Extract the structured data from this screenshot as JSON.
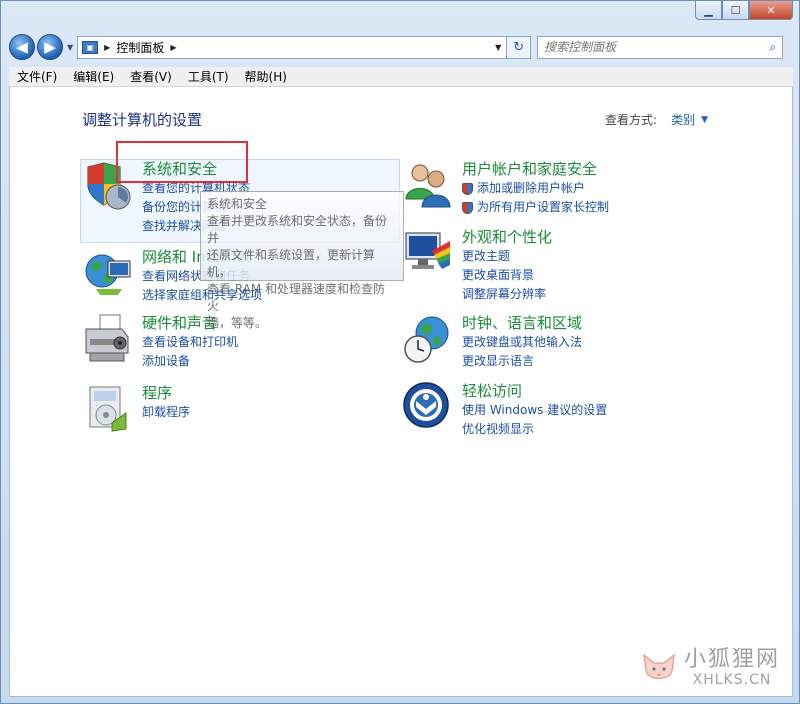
{
  "window": {
    "minimize_glyph": "▁",
    "maximize_glyph": "☐",
    "close_glyph": "✕"
  },
  "nav": {
    "back_glyph": "◀",
    "forward_glyph": "▶",
    "address_path": "控制面板",
    "refresh_glyph": "↻",
    "search_placeholder": "搜索控制面板",
    "search_glyph": "⌕"
  },
  "menu": [
    "文件(F)",
    "编辑(E)",
    "查看(V)",
    "工具(T)",
    "帮助(H)"
  ],
  "main": {
    "title": "调整计算机的设置",
    "view_by_label": "查看方式:",
    "view_by_value": "类别"
  },
  "categories": {
    "system_security": {
      "title": "系统和安全",
      "links": [
        "查看您的计算机状态",
        "备份您的计算机",
        "查找并解决问题"
      ]
    },
    "network": {
      "title": "网络和 Internet",
      "links": [
        "查看网络状态和任务",
        "选择家庭组和共享选项"
      ]
    },
    "hardware": {
      "title": "硬件和声音",
      "links": [
        "查看设备和打印机",
        "添加设备"
      ]
    },
    "programs": {
      "title": "程序",
      "links": [
        "卸载程序"
      ]
    },
    "user_accounts": {
      "title": "用户帐户和家庭安全",
      "links": [
        "添加或删除用户帐户",
        "为所有用户设置家长控制"
      ]
    },
    "appearance": {
      "title": "外观和个性化",
      "links": [
        "更改主题",
        "更改桌面背景",
        "调整屏幕分辨率"
      ]
    },
    "clock": {
      "title": "时钟、语言和区域",
      "links": [
        "更改键盘或其他输入法",
        "更改显示语言"
      ]
    },
    "ease": {
      "title": "轻松访问",
      "links": [
        "使用 Windows 建议的设置",
        "优化视频显示"
      ]
    }
  },
  "tooltip": {
    "title": "系统和安全",
    "lines": [
      "查看并更改系统和安全状态，备份并",
      "还原文件和系统设置，更新计算机，",
      "查看 RAM 和处理器速度和检查防火",
      "墙，等等。"
    ]
  },
  "watermark": {
    "cn": "小狐狸网",
    "en": "XHLKS.CN"
  },
  "colors": {
    "category_title": "#1a8c3a",
    "link": "#1c4fa8",
    "highlight_box": "#e0313a"
  }
}
